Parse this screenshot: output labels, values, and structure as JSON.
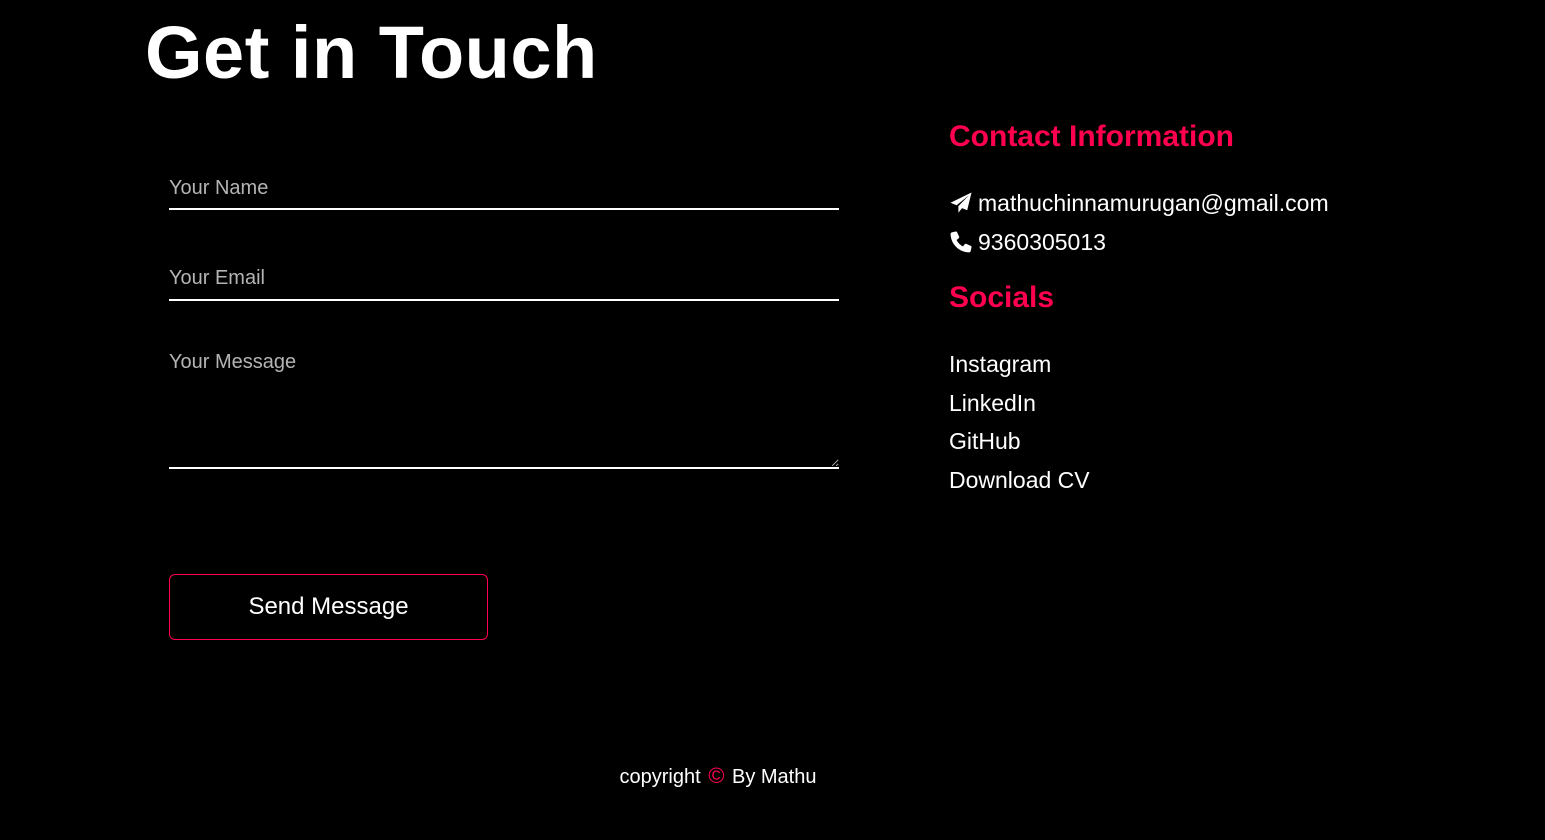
{
  "page_title": "Get in Touch",
  "form": {
    "name_placeholder": "Your Name",
    "email_placeholder": "Your Email",
    "message_placeholder": "Your Message",
    "send_label": "Send Message"
  },
  "contact": {
    "heading": "Contact Information",
    "email": "mathuchinnamurugan@gmail.com",
    "phone": "9360305013",
    "email_icon": "paper-plane-icon",
    "phone_icon": "phone-icon"
  },
  "socials": {
    "heading": "Socials",
    "links": [
      {
        "label": "Instagram"
      },
      {
        "label": "LinkedIn"
      },
      {
        "label": "GitHub"
      },
      {
        "label": "Download CV"
      }
    ]
  },
  "footer": {
    "prefix": "copyright",
    "symbol": "©",
    "suffix": "By Mathu"
  },
  "colors": {
    "background": "#000000",
    "accent": "#ff004f",
    "text": "#ffffff",
    "placeholder": "#b4b4b4"
  }
}
